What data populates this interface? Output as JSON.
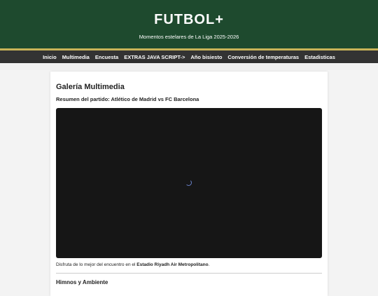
{
  "header": {
    "title": "FUTBOL+",
    "subtitle": "Momentos estelares de La Liga 2025-2026"
  },
  "nav": {
    "items": [
      {
        "label": "Inicio"
      },
      {
        "label": "Multimedia"
      },
      {
        "label": "Encuesta"
      },
      {
        "label": "EXTRAS JAVA SCRIPT->"
      },
      {
        "label": "Año bisiesto"
      },
      {
        "label": "Conversión de temperaturas"
      },
      {
        "label": "Estadisticas"
      }
    ]
  },
  "gallery": {
    "title": "Galería Multimedia",
    "video_caption": "Resumen del partido: Atlético de Madrid vs FC Barcelona",
    "description_prefix": "Disfruta de lo mejor del encuentro en el ",
    "description_venue": "Estadio Riyadh Air Metropolitano",
    "description_suffix": ".",
    "next_section_title": "Himnos y Ambiente"
  },
  "colors": {
    "header_bg": "#1e4a2e",
    "header_border": "#c9b458",
    "nav_bg": "#333333",
    "video_bg": "#161616",
    "spinner": "#6a82c8"
  },
  "icons": {
    "video_loading": "loading-spinner-icon"
  }
}
